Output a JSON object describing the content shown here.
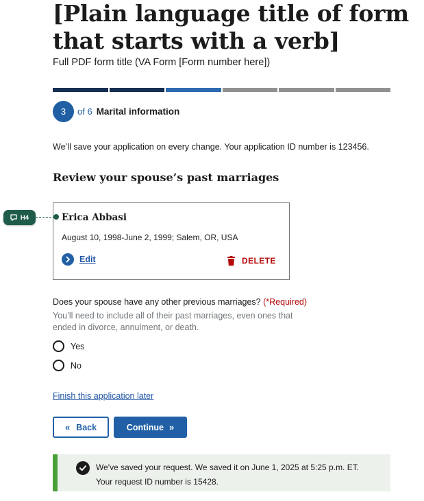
{
  "header": {
    "title": "[Plain language title of form that starts with a verb]",
    "subtitle": "Full PDF form title (VA Form [Form number here])"
  },
  "progress": {
    "total_segments": 6,
    "completed_segments": 2,
    "current_segment": 3,
    "current_step": "3",
    "of_text": "of 6",
    "step_label": "Marital information",
    "colors": {
      "complete": "#162e51",
      "current": "#2e6ab0",
      "incomplete": "#919191"
    }
  },
  "save_note": "We’ll save your application on every change. Your application ID number is 123456.",
  "section": {
    "heading": "Review your spouse’s past marriages"
  },
  "annotation_tag": {
    "label": "H4",
    "icon": "comment-icon"
  },
  "marriage_card": {
    "name": "Erica Abbasi",
    "details": "August 10, 1998-June 2, 1999; Salem, OR, USA",
    "edit_label": "Edit",
    "delete_label": "DELETE",
    "edit_icon": "chevron-right-circle-icon",
    "delete_icon": "trash-icon"
  },
  "question": {
    "text": "Does your spouse have any other previous marriages?",
    "required": "(*Required)",
    "hint": "You’ll need to include all of their past marriages, even ones that ended in divorce, annulment, or death.",
    "options": [
      {
        "label": "Yes"
      },
      {
        "label": "No"
      }
    ]
  },
  "finish_later": "Finish this application later",
  "nav": {
    "back_label": "Back",
    "continue_label": "Continue",
    "back_icon": "double-chevron-left-icon",
    "continue_icon": "double-chevron-right-icon"
  },
  "alert": {
    "line1": "We've saved your request. We saved it on June 1, 2025 at 5:25 p.m. ET.",
    "line2": "Your request ID number is 15428.",
    "icon": "check-circle-icon",
    "accent": "#4aa036"
  }
}
